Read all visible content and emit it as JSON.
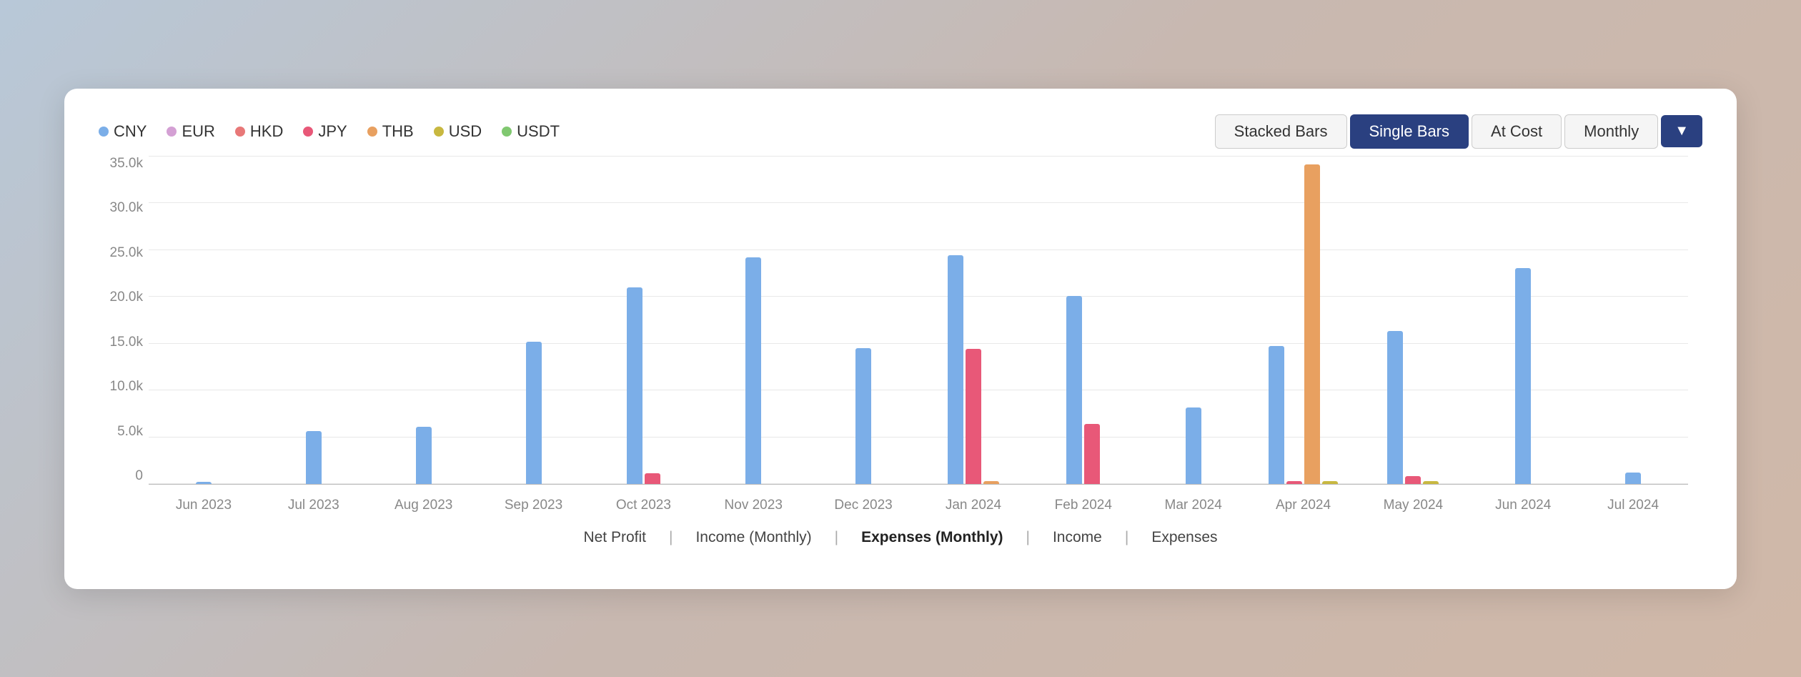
{
  "legend": {
    "items": [
      {
        "label": "CNY",
        "color": "#7baee8"
      },
      {
        "label": "EUR",
        "color": "#d4a0d4"
      },
      {
        "label": "HKD",
        "color": "#e87878"
      },
      {
        "label": "JPY",
        "color": "#e85878"
      },
      {
        "label": "THB",
        "color": "#e8a060"
      },
      {
        "label": "USD",
        "color": "#c8b840"
      },
      {
        "label": "USDT",
        "color": "#80c870"
      }
    ]
  },
  "toolbar": {
    "buttons": [
      {
        "label": "Stacked Bars",
        "active": false
      },
      {
        "label": "Single Bars",
        "active": true
      },
      {
        "label": "At Cost",
        "active": false
      },
      {
        "label": "Monthly",
        "active": false
      }
    ],
    "dropdown_icon": "▼"
  },
  "chart": {
    "y_labels": [
      "0",
      "5.0k",
      "10.0k",
      "15.0k",
      "20.0k",
      "25.0k",
      "30.0k",
      "35.0k"
    ],
    "y_max": 38000,
    "months": [
      {
        "label": "Jun 2023",
        "bars": [
          {
            "color": "#7baee8",
            "value": 300
          },
          {
            "color": "#d4a0d4",
            "value": 0
          },
          {
            "color": "#e87878",
            "value": 0
          },
          {
            "color": "#e85878",
            "value": 0
          },
          {
            "color": "#e8a060",
            "value": 0
          },
          {
            "color": "#c8b840",
            "value": 0
          }
        ]
      },
      {
        "label": "Jul 2023",
        "bars": [
          {
            "color": "#7baee8",
            "value": 6200
          },
          {
            "color": "#d4a0d4",
            "value": 0
          },
          {
            "color": "#e87878",
            "value": 0
          },
          {
            "color": "#e85878",
            "value": 0
          },
          {
            "color": "#e8a060",
            "value": 0
          },
          {
            "color": "#c8b840",
            "value": 0
          }
        ]
      },
      {
        "label": "Aug 2023",
        "bars": [
          {
            "color": "#7baee8",
            "value": 6700
          },
          {
            "color": "#d4a0d4",
            "value": 0
          },
          {
            "color": "#e87878",
            "value": 0
          },
          {
            "color": "#e85878",
            "value": 0
          },
          {
            "color": "#e8a060",
            "value": 0
          },
          {
            "color": "#c8b840",
            "value": 0
          }
        ]
      },
      {
        "label": "Sep 2023",
        "bars": [
          {
            "color": "#7baee8",
            "value": 16500
          },
          {
            "color": "#d4a0d4",
            "value": 0
          },
          {
            "color": "#e87878",
            "value": 0
          },
          {
            "color": "#e85878",
            "value": 0
          },
          {
            "color": "#e8a060",
            "value": 0
          },
          {
            "color": "#c8b840",
            "value": 0
          }
        ]
      },
      {
        "label": "Oct 2023",
        "bars": [
          {
            "color": "#7baee8",
            "value": 22800
          },
          {
            "color": "#d4a0d4",
            "value": 0
          },
          {
            "color": "#e87878",
            "value": 0
          },
          {
            "color": "#e85878",
            "value": 1300
          },
          {
            "color": "#e8a060",
            "value": 0
          },
          {
            "color": "#c8b840",
            "value": 0
          }
        ]
      },
      {
        "label": "Nov 2023",
        "bars": [
          {
            "color": "#7baee8",
            "value": 26300
          },
          {
            "color": "#d4a0d4",
            "value": 0
          },
          {
            "color": "#e87878",
            "value": 0
          },
          {
            "color": "#e85878",
            "value": 0
          },
          {
            "color": "#e8a060",
            "value": 0
          },
          {
            "color": "#c8b840",
            "value": 0
          }
        ]
      },
      {
        "label": "Dec 2023",
        "bars": [
          {
            "color": "#7baee8",
            "value": 15800
          },
          {
            "color": "#d4a0d4",
            "value": 0
          },
          {
            "color": "#e87878",
            "value": 0
          },
          {
            "color": "#e85878",
            "value": 0
          },
          {
            "color": "#e8a060",
            "value": 0
          },
          {
            "color": "#c8b840",
            "value": 0
          }
        ]
      },
      {
        "label": "Jan 2024",
        "bars": [
          {
            "color": "#7baee8",
            "value": 26500
          },
          {
            "color": "#d4a0d4",
            "value": 0
          },
          {
            "color": "#e87878",
            "value": 0
          },
          {
            "color": "#e85878",
            "value": 15700
          },
          {
            "color": "#e8a060",
            "value": 400
          },
          {
            "color": "#c8b840",
            "value": 0
          }
        ]
      },
      {
        "label": "Feb 2024",
        "bars": [
          {
            "color": "#7baee8",
            "value": 21800
          },
          {
            "color": "#d4a0d4",
            "value": 0
          },
          {
            "color": "#e87878",
            "value": 0
          },
          {
            "color": "#e85878",
            "value": 7000
          },
          {
            "color": "#e8a060",
            "value": 0
          },
          {
            "color": "#c8b840",
            "value": 0
          }
        ]
      },
      {
        "label": "Mar 2024",
        "bars": [
          {
            "color": "#7baee8",
            "value": 8900
          },
          {
            "color": "#d4a0d4",
            "value": 0
          },
          {
            "color": "#e87878",
            "value": 0
          },
          {
            "color": "#e85878",
            "value": 0
          },
          {
            "color": "#e8a060",
            "value": 0
          },
          {
            "color": "#c8b840",
            "value": 0
          }
        ]
      },
      {
        "label": "Apr 2024",
        "bars": [
          {
            "color": "#7baee8",
            "value": 16000
          },
          {
            "color": "#d4a0d4",
            "value": 0
          },
          {
            "color": "#e87878",
            "value": 0
          },
          {
            "color": "#e85878",
            "value": 400
          },
          {
            "color": "#e8a060",
            "value": 37000
          },
          {
            "color": "#c8b840",
            "value": 400
          }
        ]
      },
      {
        "label": "May 2024",
        "bars": [
          {
            "color": "#7baee8",
            "value": 17800
          },
          {
            "color": "#d4a0d4",
            "value": 0
          },
          {
            "color": "#e87878",
            "value": 0
          },
          {
            "color": "#e85878",
            "value": 1000
          },
          {
            "color": "#e8a060",
            "value": 0
          },
          {
            "color": "#c8b840",
            "value": 400
          }
        ]
      },
      {
        "label": "Jun 2024",
        "bars": [
          {
            "color": "#7baee8",
            "value": 25000
          },
          {
            "color": "#d4a0d4",
            "value": 0
          },
          {
            "color": "#e87878",
            "value": 0
          },
          {
            "color": "#e85878",
            "value": 0
          },
          {
            "color": "#e8a060",
            "value": 0
          },
          {
            "color": "#c8b840",
            "value": 0
          }
        ]
      },
      {
        "label": "Jul 2024",
        "bars": [
          {
            "color": "#7baee8",
            "value": 1400
          },
          {
            "color": "#d4a0d4",
            "value": 0
          },
          {
            "color": "#e87878",
            "value": 0
          },
          {
            "color": "#e85878",
            "value": 0
          },
          {
            "color": "#e8a060",
            "value": 0
          },
          {
            "color": "#c8b840",
            "value": 0
          }
        ]
      }
    ]
  },
  "footer": {
    "items": [
      {
        "label": "Net Profit",
        "active": false
      },
      {
        "label": "Income (Monthly)",
        "active": false
      },
      {
        "label": "Expenses (Monthly)",
        "active": true
      },
      {
        "label": "Income",
        "active": false
      },
      {
        "label": "Expenses",
        "active": false
      }
    ]
  }
}
